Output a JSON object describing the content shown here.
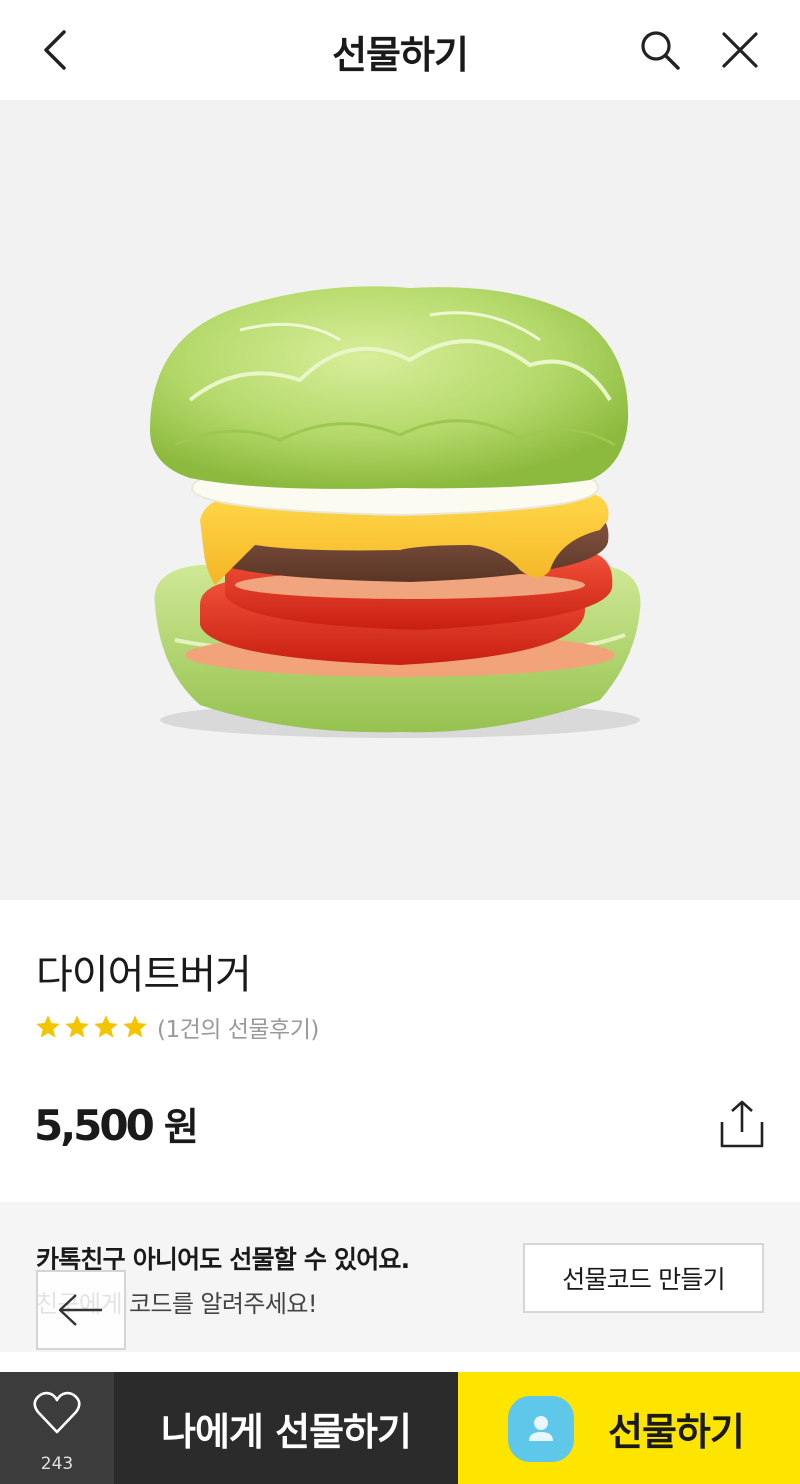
{
  "header": {
    "title": "선물하기",
    "back_icon": "chevron-left-icon",
    "search_icon": "search-icon",
    "close_icon": "close-icon"
  },
  "product": {
    "image_icon": "burger-image",
    "name": "다이어트버거",
    "rating_stars": 4,
    "review_text": "(1건의 선물후기)",
    "price": "5,500",
    "price_unit": "원",
    "share_icon": "share-icon"
  },
  "promo": {
    "line1": "카톡친구 아니어도 선물할 수 있어요.",
    "line2": "친구에게 코드를 알려주세요!",
    "button_label": "선물코드 만들기"
  },
  "float_back_icon": "arrow-left-icon",
  "bottom_bar": {
    "like_icon": "heart-icon",
    "like_count": "243",
    "gift_to_me_label": "나에게 선물하기",
    "gift_label": "선물하기",
    "gift_icon": "person-icon"
  },
  "colors": {
    "accent_yellow": "#fee500",
    "star_yellow": "#f5c400",
    "dark_bar": "#2b2b2b",
    "avatar_blue": "#5ec7ea"
  }
}
